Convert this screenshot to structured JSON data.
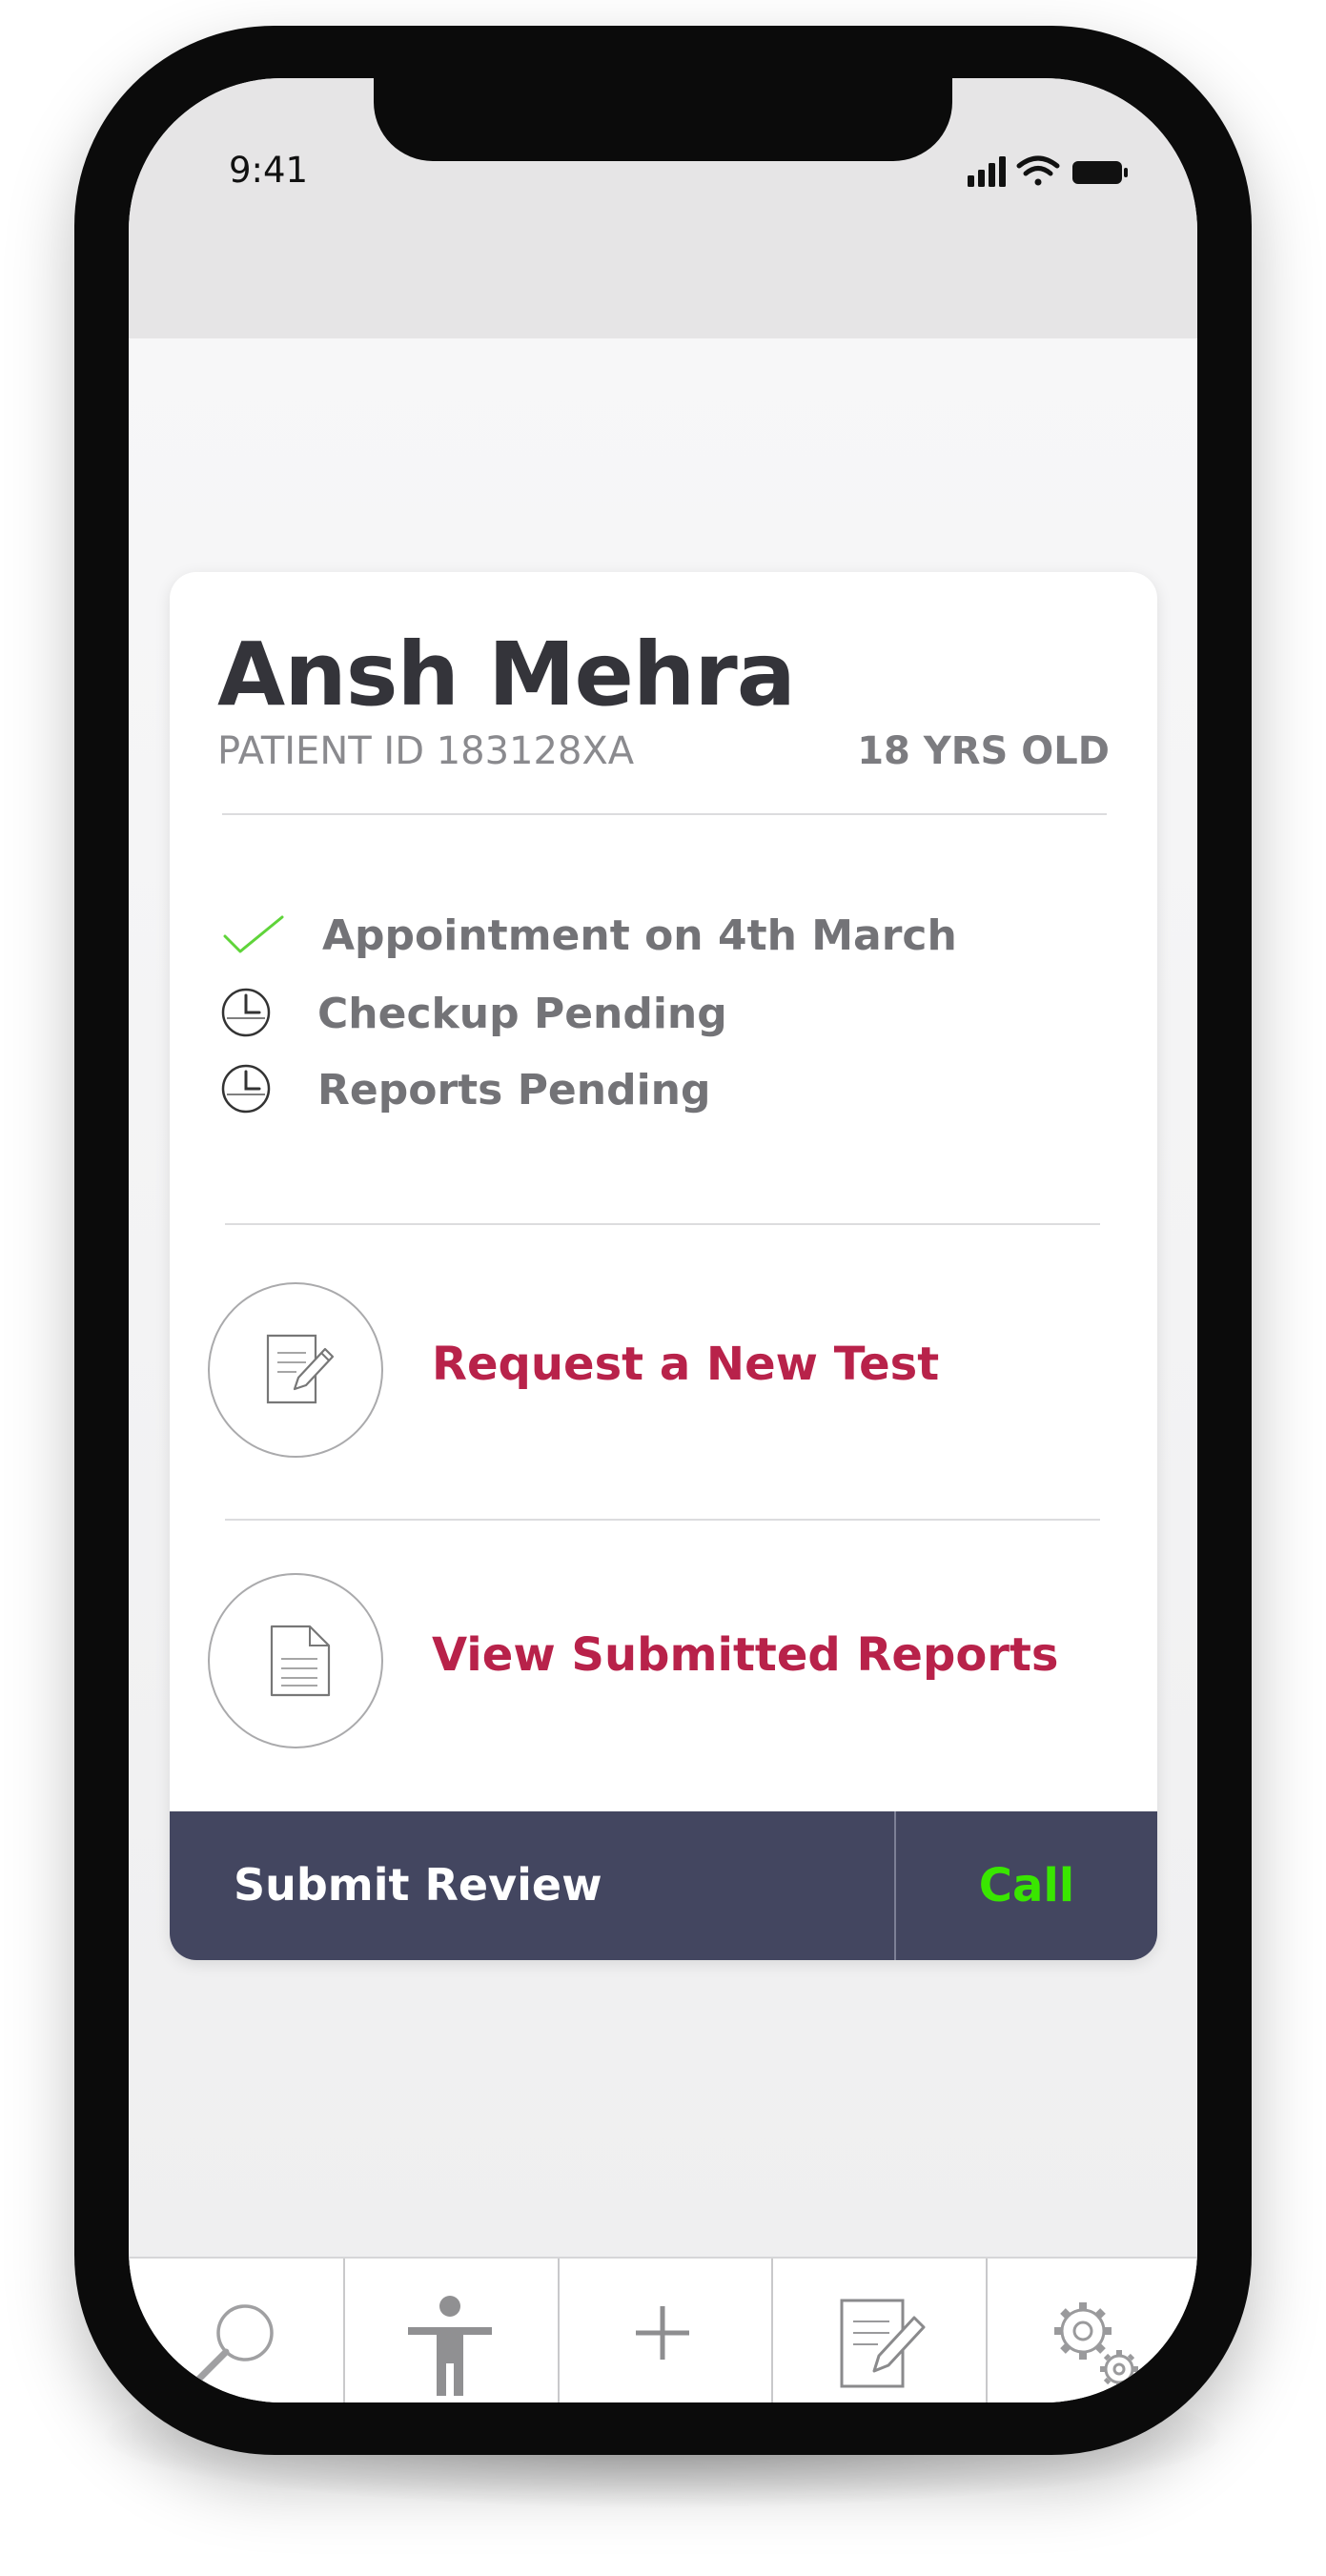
{
  "status_bar": {
    "time": "9:41"
  },
  "patient": {
    "name": "Ansh Mehra",
    "patient_id": "PATIENT ID 183128XA",
    "age": "18 YRS OLD"
  },
  "statuses": [
    {
      "label": "Appointment on 4th March",
      "icon": "checkmark-icon",
      "color": "#5fd43a"
    },
    {
      "label": "Checkup Pending",
      "icon": "clock-icon"
    },
    {
      "label": "Reports Pending",
      "icon": "clock-icon"
    }
  ],
  "actions": [
    {
      "label": "Request a New Test",
      "icon": "edit-document-icon"
    },
    {
      "label": "View Submitted Reports",
      "icon": "document-icon"
    }
  ],
  "footer": {
    "review_label": "Submit Review",
    "call_label": "Call"
  },
  "tabbar": {
    "tabs": [
      {
        "icon": "search-icon"
      },
      {
        "icon": "person-icon"
      },
      {
        "icon": "plus-icon"
      },
      {
        "icon": "edit-document-icon"
      },
      {
        "icon": "settings-gears-icon"
      }
    ]
  },
  "colors": {
    "accent": "#b8224a",
    "footer_bg": "#434660",
    "call": "#39e600",
    "success": "#5fd43a"
  }
}
